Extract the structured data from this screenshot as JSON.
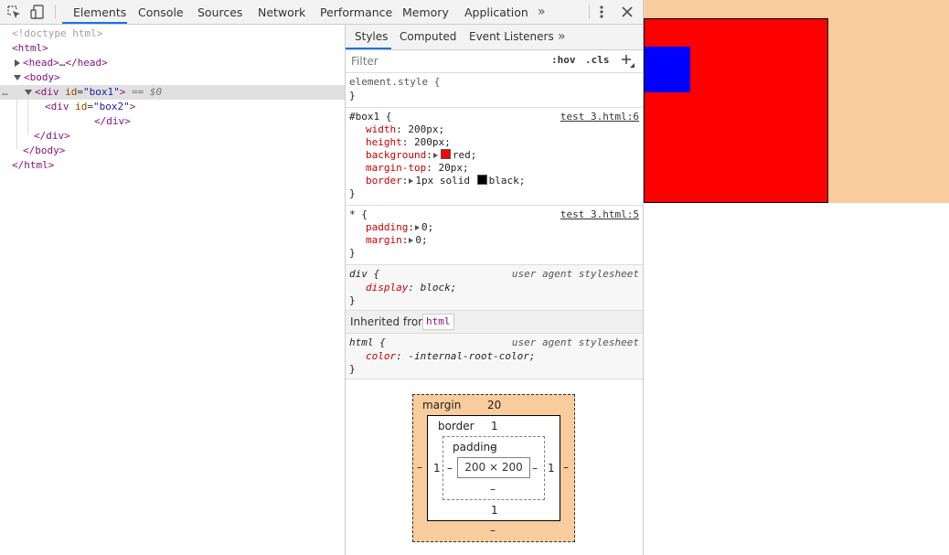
{
  "toolbar": {
    "tabs": [
      "Elements",
      "Console",
      "Sources",
      "Network",
      "Performance",
      "Memory",
      "Application"
    ],
    "overflow": "»",
    "active_tab": "Elements"
  },
  "dom": {
    "doctype": "<!doctype html>",
    "html_open": "<html>",
    "head_tag": "<head>",
    "head_ellipsis": "…",
    "head_close": "</head>",
    "body_open": "<body>",
    "div_open_tag": "<div",
    "div_attr_name": "id",
    "box1_id": "\"box1\"",
    "div_open_end": ">",
    "selected_suffix": "== $0",
    "box2_id": "\"box2\"",
    "div_close": "</div>",
    "body_close": "</body>",
    "html_close": "</html>",
    "dots": "…"
  },
  "styles": {
    "tabs": [
      "Styles",
      "Computed",
      "Event Listeners"
    ],
    "overflow": "»",
    "filter_placeholder": "Filter",
    "hov": ":hov",
    "cls": ".cls",
    "element_style": "element.style {",
    "close_brace": "}",
    "rules": {
      "box1": {
        "selector": "#box1 {",
        "source": "test 3.html:6",
        "props": [
          {
            "name": "width",
            "value": "200px;"
          },
          {
            "name": "height",
            "value": "200px;"
          },
          {
            "name": "background",
            "value": "red;",
            "swatch": "#ff0000"
          },
          {
            "name": "margin-top",
            "value": "20px;"
          },
          {
            "name": "border",
            "value": "1px solid",
            "value2": "black;",
            "swatch": "#000000"
          }
        ]
      },
      "star": {
        "selector": "* {",
        "source": "test 3.html:5",
        "props": [
          {
            "name": "padding",
            "value": "0;"
          },
          {
            "name": "margin",
            "value": "0;"
          }
        ]
      },
      "div": {
        "selector": "div {",
        "source": "user agent stylesheet",
        "props": [
          {
            "name": "display",
            "value": "block;"
          }
        ]
      },
      "html": {
        "selector": "html {",
        "source": "user agent stylesheet",
        "props": [
          {
            "name": "color",
            "value": "-internal-root-color;"
          }
        ]
      }
    },
    "inherited_from": "Inherited from",
    "inherited_tag": "html"
  },
  "box_model": {
    "margin_label": "margin",
    "margin_top": "20",
    "margin_right": "–",
    "margin_bottom": "–",
    "margin_left": "–",
    "border_label": "border",
    "border_top": "1",
    "border_right": "1",
    "border_bottom": "1",
    "border_left": "1",
    "padding_label": "padding",
    "padding_top": "–",
    "padding_right": "–",
    "padding_bottom": "–",
    "padding_left": "–",
    "content": "200 × 200"
  },
  "viewport": {
    "html_bg": "#f9cc9d",
    "box1_color": "#ff0000",
    "box2_color": "#0000ff"
  }
}
